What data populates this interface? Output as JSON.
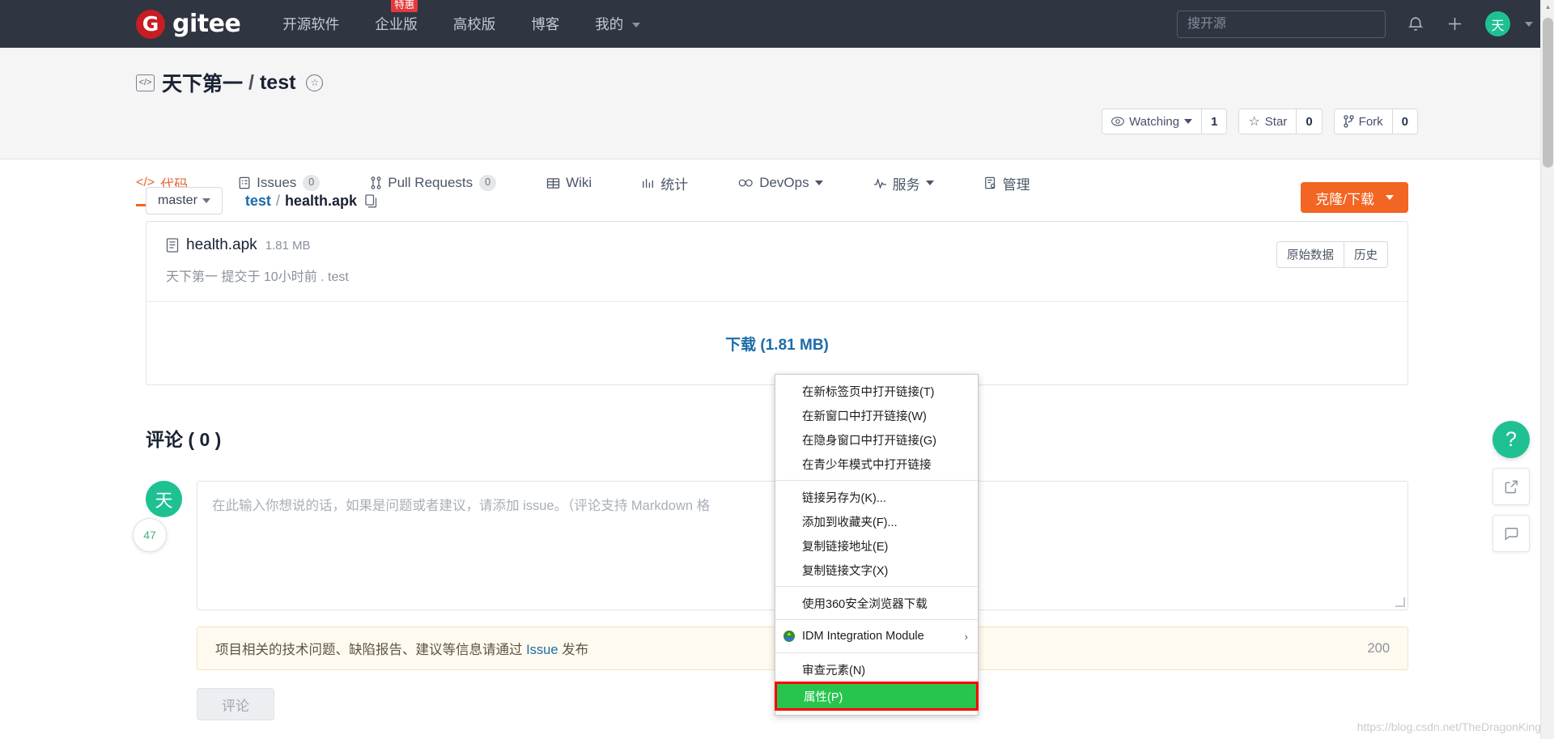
{
  "topnav": {
    "brand": {
      "mark": "G",
      "name": "gitee"
    },
    "links": [
      {
        "label": "开源软件",
        "badge": null,
        "caret": false
      },
      {
        "label": "企业版",
        "badge": "特惠",
        "caret": false
      },
      {
        "label": "高校版",
        "badge": null,
        "caret": false
      },
      {
        "label": "博客",
        "badge": null,
        "caret": false
      },
      {
        "label": "我的",
        "badge": null,
        "caret": true
      }
    ],
    "search_placeholder": "搜开源",
    "search_value": "",
    "notification_icon": "bell-icon",
    "add_icon": "plus-icon",
    "avatar_text": "天"
  },
  "repo": {
    "code_icon": "</>",
    "owner": "天下第一",
    "separator": "/",
    "name": "test",
    "star_badge_icon": "☆",
    "actions": [
      {
        "icon": "eye-icon",
        "label": "Watching",
        "caret": true,
        "count": "1"
      },
      {
        "icon": "star-icon",
        "label": "Star",
        "caret": false,
        "count": "0"
      },
      {
        "icon": "fork-icon",
        "label": "Fork",
        "caret": false,
        "count": "0"
      }
    ]
  },
  "tabs": [
    {
      "icon": "code-icon",
      "label": "代码",
      "count": null,
      "caret": false,
      "active": true
    },
    {
      "icon": "issues-icon",
      "label": "Issues",
      "count": "0",
      "caret": false,
      "active": false
    },
    {
      "icon": "pullrequest-icon",
      "label": "Pull Requests",
      "count": "0",
      "caret": false,
      "active": false
    },
    {
      "icon": "wiki-icon",
      "label": "Wiki",
      "count": null,
      "caret": false,
      "active": false
    },
    {
      "icon": "stats-icon",
      "label": "统计",
      "count": null,
      "caret": false,
      "active": false
    },
    {
      "icon": "devops-icon",
      "label": "DevOps",
      "count": null,
      "caret": true,
      "active": false
    },
    {
      "icon": "service-icon",
      "label": "服务",
      "count": null,
      "caret": true,
      "active": false
    },
    {
      "icon": "manage-icon",
      "label": "管理",
      "count": null,
      "caret": false,
      "active": false
    }
  ],
  "file_toolbar": {
    "branch": "master",
    "crumb_repo": "test",
    "crumb_sep": "/",
    "crumb_file": "health.apk",
    "copy_icon": "copy-icon",
    "clone_button": "克隆/下载"
  },
  "file_card": {
    "file_icon": "file-icon",
    "filename": "health.apk",
    "filesize": "1.81 MB",
    "commit_line": "天下第一 提交于 10小时前 . test",
    "actions": [
      "原始数据",
      "历史"
    ],
    "download_label": "下载 (1.81 MB)"
  },
  "comments": {
    "title": "评论 ( 0 )",
    "avatar_text": "天",
    "placeholder": "在此输入你想说的话，如果是问题或者建议，请添加 issue。（评论支持 Markdown 格",
    "notice_prefix": "项目相关的技术问题、缺陷报告、建议等信息请通过",
    "notice_link": "Issue",
    "notice_suffix": "发布",
    "notice_count": "200",
    "submit_label": "评论"
  },
  "context_menu": {
    "groups": [
      {
        "items": [
          {
            "label": "在新标签页中打开链接(T)",
            "icon": null,
            "arrow": false,
            "highlight": false
          },
          {
            "label": "在新窗口中打开链接(W)",
            "icon": null,
            "arrow": false,
            "highlight": false
          },
          {
            "label": "在隐身窗口中打开链接(G)",
            "icon": null,
            "arrow": false,
            "highlight": false
          },
          {
            "label": "在青少年模式中打开链接",
            "icon": null,
            "arrow": false,
            "highlight": false
          }
        ]
      },
      {
        "items": [
          {
            "label": "链接另存为(K)...",
            "icon": null,
            "arrow": false,
            "highlight": false
          },
          {
            "label": "添加到收藏夹(F)...",
            "icon": null,
            "arrow": false,
            "highlight": false
          },
          {
            "label": "复制链接地址(E)",
            "icon": null,
            "arrow": false,
            "highlight": false
          },
          {
            "label": "复制链接文字(X)",
            "icon": null,
            "arrow": false,
            "highlight": false
          }
        ]
      },
      {
        "items": [
          {
            "label": "使用360安全浏览器下载",
            "icon": null,
            "arrow": false,
            "highlight": false
          }
        ]
      },
      {
        "items": [
          {
            "label": "IDM Integration Module",
            "icon": "idm-icon",
            "arrow": true,
            "highlight": false
          }
        ]
      },
      {
        "items": [
          {
            "label": "审查元素(N)",
            "icon": null,
            "arrow": false,
            "highlight": false
          },
          {
            "label": "属性(P)",
            "icon": null,
            "arrow": false,
            "highlight": true
          }
        ]
      }
    ]
  },
  "floating": {
    "help_icon": "?",
    "share_icon": "share-icon",
    "feedback_icon": "chat-icon",
    "left_bubble": "47"
  },
  "watermark": "https://blog.csdn.net/TheDragonKing",
  "colors": {
    "nav_bg": "#2f3541",
    "brand_red": "#c71d23",
    "accent_orange": "#f26522",
    "green": "#1fc193",
    "highlight_green": "#27c54d",
    "highlight_border_red": "#fe0000",
    "link_blue": "#1b6ca8"
  }
}
